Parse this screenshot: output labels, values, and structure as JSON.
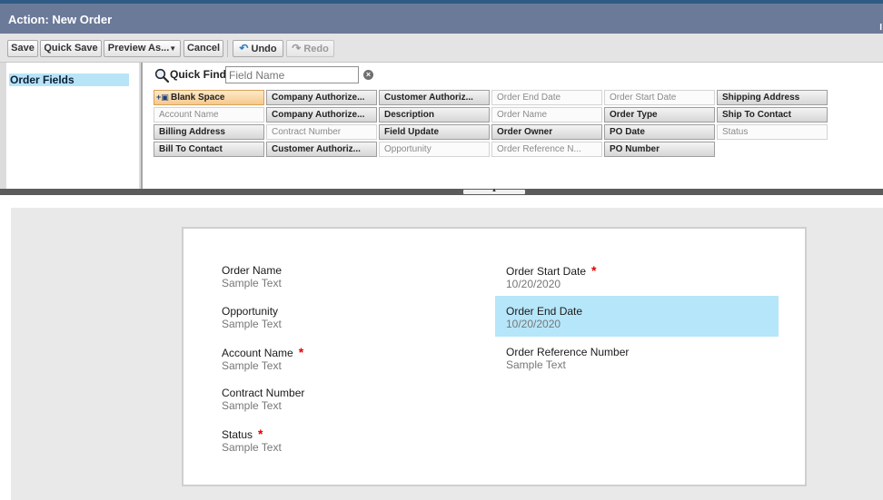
{
  "window": {
    "title": "Action: New Order",
    "edge_glyph": "I"
  },
  "toolbar": {
    "save": "Save",
    "quick_save": "Quick Save",
    "preview_as": "Preview As...",
    "cancel": "Cancel",
    "undo": "Undo",
    "redo": "Redo"
  },
  "palette": {
    "categories": [
      "Order Fields"
    ],
    "quick_find": {
      "label": "Quick Find",
      "placeholder": "Field Name"
    },
    "fields": [
      {
        "label": "Blank Space",
        "state": "blank"
      },
      {
        "label": "Company Authorize...",
        "state": "available"
      },
      {
        "label": "Customer Authoriz...",
        "state": "available"
      },
      {
        "label": "Order End Date",
        "state": "used"
      },
      {
        "label": "Order Start Date",
        "state": "used"
      },
      {
        "label": "Shipping Address",
        "state": "available"
      },
      {
        "label": "Account Name",
        "state": "used"
      },
      {
        "label": "Company Authorize...",
        "state": "available"
      },
      {
        "label": "Description",
        "state": "available"
      },
      {
        "label": "Order Name",
        "state": "used"
      },
      {
        "label": "Order Type",
        "state": "available"
      },
      {
        "label": "Ship To Contact",
        "state": "available"
      },
      {
        "label": "Billing Address",
        "state": "available"
      },
      {
        "label": "Contract Number",
        "state": "used"
      },
      {
        "label": "Field Update",
        "state": "available"
      },
      {
        "label": "Order Owner",
        "state": "available"
      },
      {
        "label": "PO Date",
        "state": "available"
      },
      {
        "label": "Status",
        "state": "used"
      },
      {
        "label": "Bill To Contact",
        "state": "available"
      },
      {
        "label": "Customer Authoriz...",
        "state": "available"
      },
      {
        "label": "Opportunity",
        "state": "used"
      },
      {
        "label": "Order Reference N...",
        "state": "used"
      },
      {
        "label": "PO Number",
        "state": "available"
      }
    ]
  },
  "layout": {
    "left_column": [
      {
        "label": "Order Name",
        "value": "Sample Text",
        "required": false
      },
      {
        "label": "Opportunity",
        "value": "Sample Text",
        "required": false
      },
      {
        "label": "Account Name",
        "value": "Sample Text",
        "required": true
      },
      {
        "label": "Contract Number",
        "value": "Sample Text",
        "required": false
      },
      {
        "label": "Status",
        "value": "Sample Text",
        "required": true
      }
    ],
    "right_column": [
      {
        "label": "Order Start Date",
        "value": "10/20/2020",
        "required": true,
        "selected": false
      },
      {
        "label": "Order End Date",
        "value": "10/20/2020",
        "required": false,
        "selected": true
      },
      {
        "label": "Order Reference Number",
        "value": "Sample Text",
        "required": false,
        "selected": false
      }
    ],
    "required_mark": "*"
  },
  "colors": {
    "title_bar": "#6b7a99",
    "selected_field": "#b6e6f9",
    "required": "#e00000",
    "blank_space": "#f6c98c"
  }
}
